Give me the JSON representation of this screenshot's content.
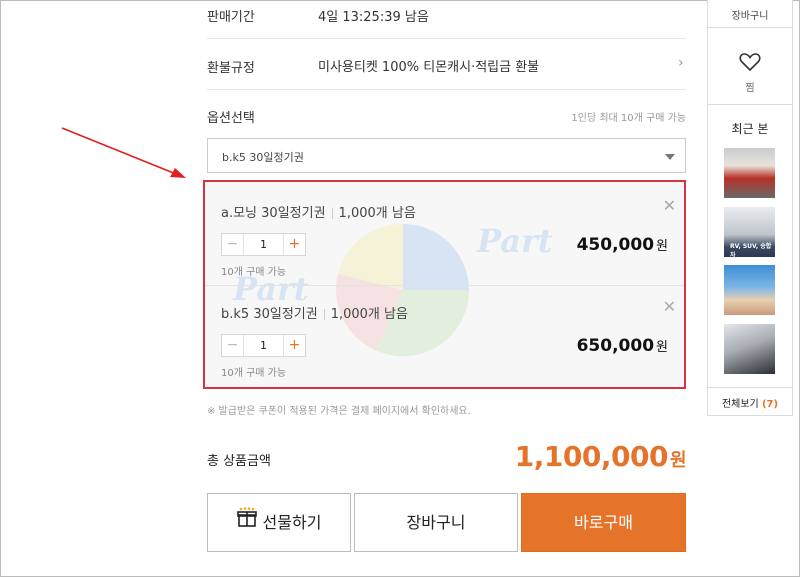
{
  "info": {
    "sale_period_label": "판매기간",
    "sale_period_value": "4일 13:25:39 남음",
    "refund_label": "환불규정",
    "refund_value": "미사용티켓 100% 티몬캐시·적립금 환불"
  },
  "option": {
    "label": "옵션선택",
    "limit_note": "1인당 최대 10개 구매 가능",
    "selected_value": "b.k5 30일정기권"
  },
  "selected_options": [
    {
      "name": "a.모닝 30일정기권",
      "stock": "1,000개 남음",
      "quantity": "1",
      "limit": "10개 구매 가능",
      "price": "450,000",
      "currency": "원"
    },
    {
      "name": "b.k5 30일정기권",
      "stock": "1,000개 남음",
      "quantity": "1",
      "limit": "10개 구매 가능",
      "price": "650,000",
      "currency": "원"
    }
  ],
  "coupon_note": "※ 발급받은 쿠폰이 적용된 가격은 결제 페이지에서 확인하세요.",
  "total": {
    "label": "총 상품금액",
    "amount": "1,100,000",
    "currency": "원"
  },
  "actions": {
    "gift": "선물하기",
    "cart": "장바구니",
    "buy": "바로구매"
  },
  "sidebar": {
    "cart_label": "장바구니",
    "zzim_label": "찜",
    "recent_label": "최근 본",
    "thumb2_text": "RV, SUV, 승합차",
    "view_all_label": "전체보기",
    "view_all_count": "(7)"
  },
  "watermark": "Part",
  "colors": {
    "accent": "#e5742a",
    "highlight_box": "#d9333f",
    "arrow": "#e02020"
  },
  "icons": {
    "close": "close-icon",
    "chevron": "chevron-right-icon",
    "heart": "heart-icon",
    "gift": "gift-icon",
    "caret": "caret-down-icon"
  }
}
